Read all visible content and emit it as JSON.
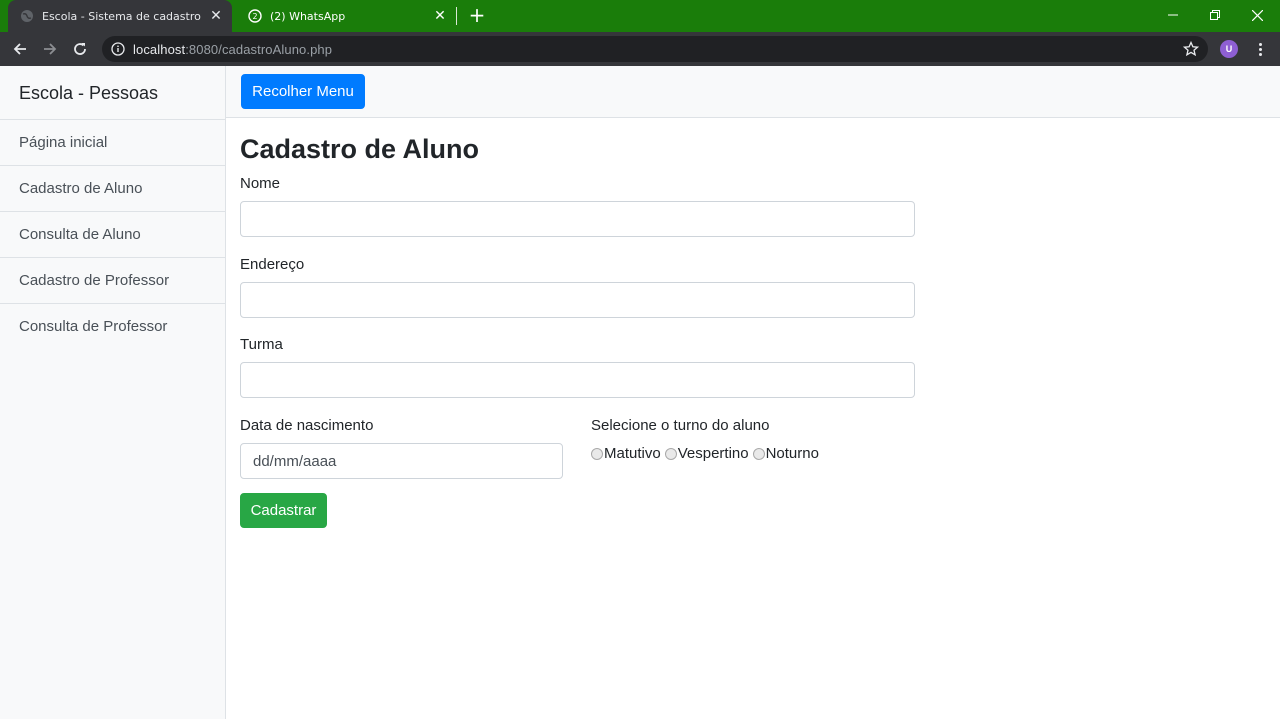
{
  "browser": {
    "tabs": [
      {
        "title": "Escola - Sistema de cadastro",
        "active": true
      },
      {
        "title": "(2) WhatsApp",
        "active": false
      }
    ],
    "url_host": "localhost",
    "url_rest": ":8080/cadastroAluno.php",
    "profile_initial": "U",
    "accent_color": "#1a7d0a"
  },
  "sidebar": {
    "heading": "Escola - Pessoas",
    "items": [
      {
        "label": "Página inicial"
      },
      {
        "label": "Cadastro de Aluno"
      },
      {
        "label": "Consulta de Aluno"
      },
      {
        "label": "Cadastro de Professor"
      },
      {
        "label": "Consulta de Professor"
      }
    ]
  },
  "topnav": {
    "toggle_label": "Recolher Menu"
  },
  "form": {
    "title": "Cadastro de Aluno",
    "nome_label": "Nome",
    "endereco_label": "Endereço",
    "turma_label": "Turma",
    "nascimento_label": "Data de nascimento",
    "nascimento_placeholder": "dd/mm/aaaa",
    "turno_label": "Selecione o turno do aluno",
    "turno_options": [
      "Matutivo",
      "Vespertino",
      "Noturno"
    ],
    "submit_label": "Cadastrar"
  }
}
